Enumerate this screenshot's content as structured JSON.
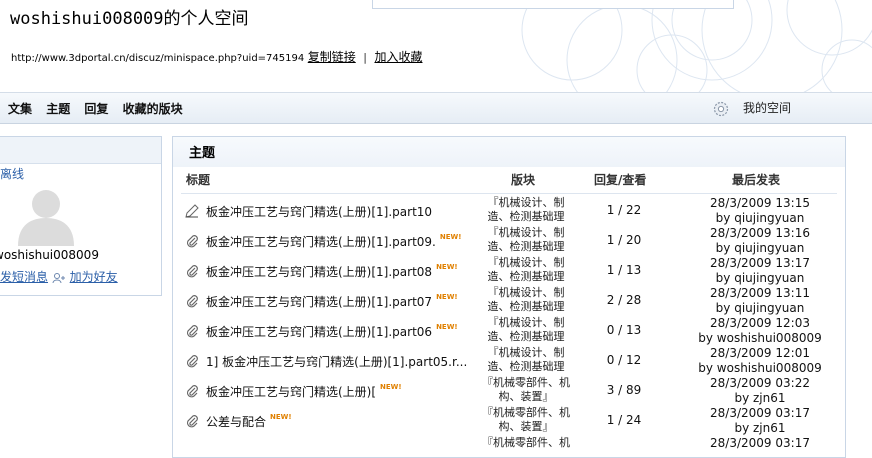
{
  "header": {
    "title": "woshishui008009的个人空间",
    "url": "http://www.3dportal.cn/discuz/minispace.php?uid=745194",
    "copy_link": "复制链接",
    "separator": "|",
    "add_favorite": "加入收藏"
  },
  "nav": {
    "items": [
      "文集",
      "主题",
      "回复",
      "收藏的版块"
    ],
    "my_space": "我的空间"
  },
  "profile": {
    "status": "离线",
    "username": "woshishui008009",
    "send_message": "发短消息",
    "add_friend": "加为好友"
  },
  "topics": {
    "heading": "主题",
    "columns": {
      "subject": "标题",
      "forum": "版块",
      "stats": "回复/查看",
      "last": "最后发表"
    },
    "new_badge": "NEW!",
    "rows": [
      {
        "subject": "板金冲压工艺与窍门精选(上册)[1].part10",
        "new": false,
        "forum1": "『机械设计、制",
        "forum2": "造、检测基础理",
        "stats": "1 / 22",
        "last_date": "28/3/2009 13:15",
        "last_by": "by qiujingyuan"
      },
      {
        "subject": "板金冲压工艺与窍门精选(上册)[1].part09.",
        "new": true,
        "forum1": "『机械设计、制",
        "forum2": "造、检测基础理",
        "stats": "1 / 20",
        "last_date": "28/3/2009 13:16",
        "last_by": "by qiujingyuan"
      },
      {
        "subject": "板金冲压工艺与窍门精选(上册)[1].part08",
        "new": true,
        "forum1": "『机械设计、制",
        "forum2": "造、检测基础理",
        "stats": "1 / 13",
        "last_date": "28/3/2009 13:17",
        "last_by": "by qiujingyuan"
      },
      {
        "subject": "板金冲压工艺与窍门精选(上册)[1].part07",
        "new": true,
        "forum1": "『机械设计、制",
        "forum2": "造、检测基础理",
        "stats": "2 / 28",
        "last_date": "28/3/2009 13:11",
        "last_by": "by qiujingyuan"
      },
      {
        "subject": "板金冲压工艺与窍门精选(上册)[1].part06",
        "new": true,
        "forum1": "『机械设计、制",
        "forum2": "造、检测基础理",
        "stats": "0 / 13",
        "last_date": "28/3/2009 12:03",
        "last_by": "by woshishui008009"
      },
      {
        "subject": "1] 板金冲压工艺与窍门精选(上册)[1].part05.r...",
        "new": false,
        "forum1": "『机械设计、制",
        "forum2": "造、检测基础理",
        "stats": "0 / 12",
        "last_date": "28/3/2009 12:01",
        "last_by": "by woshishui008009"
      },
      {
        "subject": "板金冲压工艺与窍门精选(上册)[",
        "new": true,
        "forum1": "『机械零部件、机",
        "forum2": "构、装置』",
        "stats": "3 / 89",
        "last_date": "28/3/2009 03:22",
        "last_by": "by zjn61"
      },
      {
        "subject": "公差与配合",
        "new": true,
        "forum1": "『机械零部件、机",
        "forum2": "构、装置』",
        "stats": "1 / 24",
        "last_date": "28/3/2009 03:17",
        "last_by": "by zjn61"
      },
      {
        "subject": "",
        "new": false,
        "forum1": "『机械零部件、机",
        "forum2": "",
        "stats": "",
        "last_date": "28/3/2009 03:17",
        "last_by": ""
      }
    ]
  }
}
